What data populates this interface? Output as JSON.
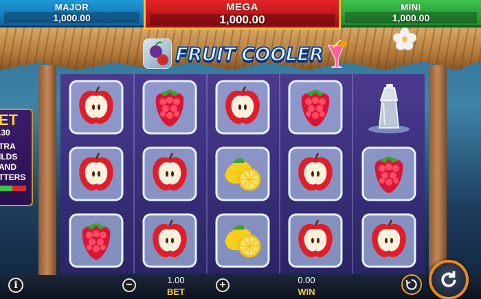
{
  "jackpots": {
    "major": {
      "label": "MAJOR",
      "value": "1,000.00",
      "color": "#1e9ad6"
    },
    "mega": {
      "label": "MEGA",
      "value": "1,000.00",
      "color": "#e52525"
    },
    "mini": {
      "label": "MINI",
      "value": "1,000.00",
      "color": "#3fc24d"
    }
  },
  "logo": {
    "text": "FRUIT COOLER"
  },
  "side_panel": {
    "bet_title": "ET",
    "bet_amount": ".30",
    "feature_lines": [
      "TRA",
      "ILDS",
      "AND",
      "TTERS"
    ]
  },
  "reels": [
    [
      "apple-ice-icon",
      "raspberry-ice-icon",
      "apple-ice-icon",
      "raspberry-ice-icon",
      "shaker-icon"
    ],
    [
      "apple-ice-icon",
      "apple-ice-icon",
      "lemon-ice-icon",
      "apple-ice-icon",
      "raspberry-ice-icon"
    ],
    [
      "raspberry-ice-icon",
      "apple-ice-icon",
      "lemon-ice-icon",
      "apple-ice-icon",
      "apple-ice-icon"
    ]
  ],
  "bottom_bar": {
    "bet_value": "1.00",
    "bet_label": "BET",
    "win_value": "0.00",
    "win_label": "WIN",
    "info_symbol": "i",
    "minus_symbol": "−",
    "plus_symbol": "+"
  },
  "colors": {
    "reel_bg": "#3a2f7c",
    "accent_gold": "#f5c542",
    "spin_ring": "#f08a1a"
  }
}
